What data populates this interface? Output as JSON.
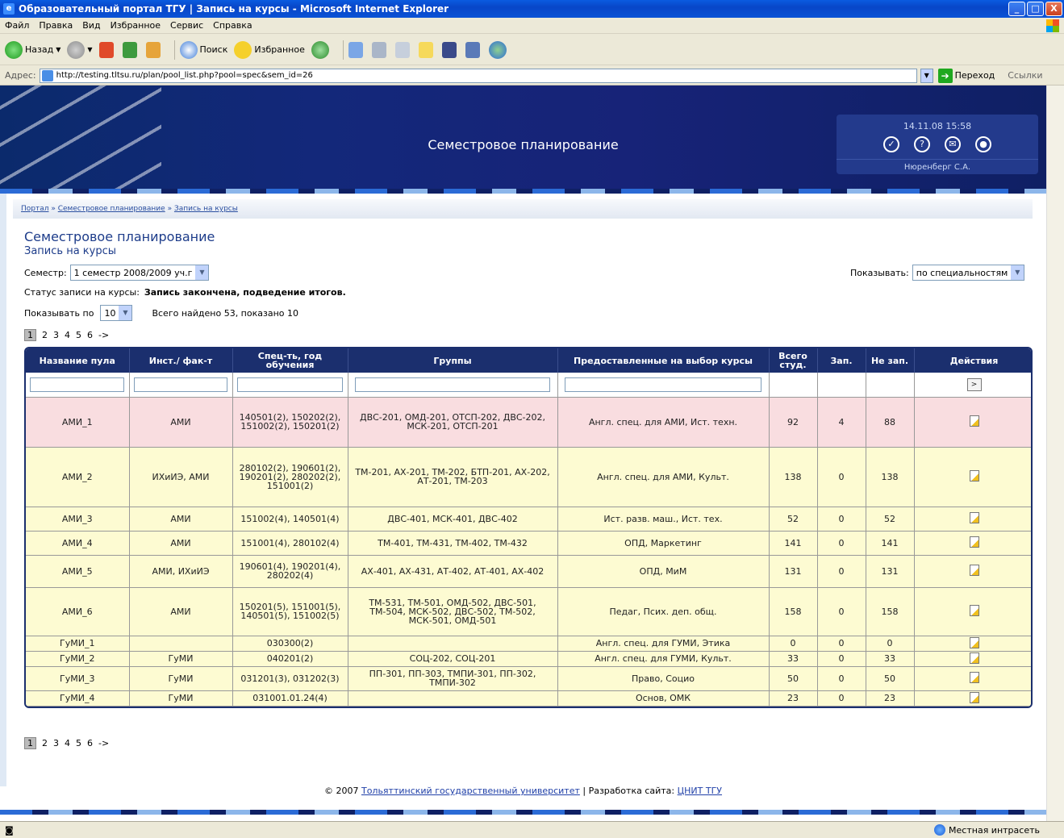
{
  "window": {
    "title": "Образовательный портал ТГУ | Запись на курсы - Microsoft Internet Explorer",
    "buttons": [
      "_",
      "□",
      "X"
    ]
  },
  "menu": [
    "Файл",
    "Правка",
    "Вид",
    "Избранное",
    "Сервис",
    "Справка"
  ],
  "toolbar": {
    "back": "Назад",
    "search": "Поиск",
    "favorites": "Избранное"
  },
  "address": {
    "label": "Адрес:",
    "url": "http://testing.tltsu.ru/plan/pool_list.php?pool=spec&sem_id=26",
    "go": "Переход",
    "links": "Ссылки"
  },
  "banner": {
    "title": "Семестровое планирование",
    "datetime": "14.11.08 15:58",
    "user": "Нюренберг С.А."
  },
  "breadcrumb": [
    "Портал",
    "Семестровое планирование",
    "Запись на курсы"
  ],
  "heading": "Семестровое планирование",
  "subheading": "Запись на курсы",
  "semester": {
    "label": "Семестр:",
    "value": "1 семестр 2008/2009 уч.г"
  },
  "show_by": {
    "label": "Показывать:",
    "value": "по специальностям"
  },
  "status": {
    "label": "Статус записи на курсы:",
    "value": "Запись закончена, подведение итогов."
  },
  "per_page": {
    "label": "Показывать по",
    "value": "10",
    "summary": "Всего найдено 53, показано 10"
  },
  "pager": {
    "current": "1",
    "pages": [
      "2",
      "3",
      "4",
      "5",
      "6"
    ],
    "next": "->"
  },
  "table": {
    "headers": [
      "Название пула",
      "Инст./ фак-т",
      "Спец-ть, год обучения",
      "Группы",
      "Предоставленные на выбор курсы",
      "Всего студ.",
      "Зап.",
      "Не зап.",
      "Действия"
    ],
    "filter_go": ">",
    "rows": [
      {
        "name": "АМИ_1",
        "inst": "АМИ",
        "spec": "140501(2), 150202(2), 151002(2), 150201(2)",
        "groups": "ДВС-201, ОМД-201, ОТСП-202, ДВС-202, МСК-201, ОТСП-201",
        "courses": "Англ. спец. для АМИ, Ист. техн.",
        "total": "92",
        "enrolled": "4",
        "not_enrolled": "88",
        "style": "pink"
      },
      {
        "name": "АМИ_2",
        "inst": "ИХиИЭ, АМИ",
        "spec": "280102(2), 190601(2), 190201(2), 280202(2), 151001(2)",
        "groups": "ТМ-201, АХ-201, ТМ-202, БТП-201, АХ-202, АТ-201, ТМ-203",
        "courses": "Англ. спец. для АМИ, Культ.",
        "total": "138",
        "enrolled": "0",
        "not_enrolled": "138",
        "style": "yellow"
      },
      {
        "name": "АМИ_3",
        "inst": "АМИ",
        "spec": "151002(4), 140501(4)",
        "groups": "ДВС-401, МСК-401, ДВС-402",
        "courses": "Ист. разв. маш., Ист. тех.",
        "total": "52",
        "enrolled": "0",
        "not_enrolled": "52",
        "style": "yellow"
      },
      {
        "name": "АМИ_4",
        "inst": "АМИ",
        "spec": "151001(4), 280102(4)",
        "groups": "ТМ-401, ТМ-431, ТМ-402, ТМ-432",
        "courses": "ОПД, Маркетинг",
        "total": "141",
        "enrolled": "0",
        "not_enrolled": "141",
        "style": "yellow"
      },
      {
        "name": "АМИ_5",
        "inst": "АМИ, ИХиИЭ",
        "spec": "190601(4), 190201(4), 280202(4)",
        "groups": "АХ-401, АХ-431, АТ-402, АТ-401, АХ-402",
        "courses": "ОПД, МиМ",
        "total": "131",
        "enrolled": "0",
        "not_enrolled": "131",
        "style": "yellow"
      },
      {
        "name": "АМИ_6",
        "inst": "АМИ",
        "spec": "150201(5), 151001(5), 140501(5), 151002(5)",
        "groups": "ТМ-531, ТМ-501, ОМД-502, ДВС-501, ТМ-504, МСК-502, ДВС-502, ТМ-502, МСК-501, ОМД-501",
        "courses": "Педаг, Псих. деп. общ.",
        "total": "158",
        "enrolled": "0",
        "not_enrolled": "158",
        "style": "yellow"
      },
      {
        "name": "ГуМИ_1",
        "inst": "",
        "spec": "030300(2)",
        "groups": "",
        "courses": "Англ. спец. для ГУМИ, Этика",
        "total": "0",
        "enrolled": "0",
        "not_enrolled": "0",
        "style": "yellow"
      },
      {
        "name": "ГуМИ_2",
        "inst": "ГуМИ",
        "spec": "040201(2)",
        "groups": "СОЦ-202, СОЦ-201",
        "courses": "Англ. спец. для ГУМИ, Культ.",
        "total": "33",
        "enrolled": "0",
        "not_enrolled": "33",
        "style": "yellow"
      },
      {
        "name": "ГуМИ_3",
        "inst": "ГуМИ",
        "spec": "031201(3), 031202(3)",
        "groups": "ПП-301, ПП-303, ТМПИ-301, ПП-302, ТМПИ-302",
        "courses": "Право, Социо",
        "total": "50",
        "enrolled": "0",
        "not_enrolled": "50",
        "style": "yellow"
      },
      {
        "name": "ГуМИ_4",
        "inst": "ГуМИ",
        "spec": "031001.01.24(4)",
        "groups": "",
        "courses": "Основ, ОМК",
        "total": "23",
        "enrolled": "0",
        "not_enrolled": "23",
        "style": "yellow"
      }
    ]
  },
  "footer": {
    "copyright": "© 2007",
    "university": "Тольяттинский государственный университет",
    "separator": "| Разработка сайта:",
    "dev": "ЦНИТ ТГУ"
  },
  "statusbar": {
    "zone": "Местная интрасеть"
  }
}
